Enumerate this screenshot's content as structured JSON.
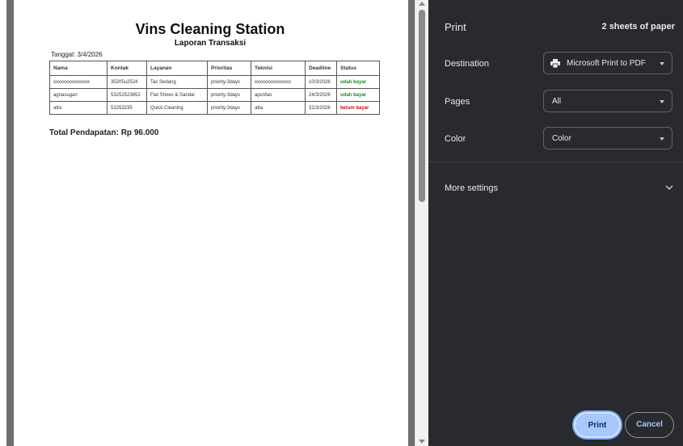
{
  "document": {
    "title": "Vins Cleaning Station",
    "subtitle": "Laporan Transaksi",
    "date_line": "Tanggal: 3/4/2026",
    "columns": [
      "Nama",
      "Kontak",
      "Layanan",
      "Prioritas",
      "Teknisi",
      "Deadline",
      "Status"
    ],
    "rows": [
      [
        "xxxxxxxxxxxxxxx",
        "35205u2524",
        "Tac Sedang",
        "priority-3days",
        "xxxxxxxxxxxxxxx",
        "10/3/2026",
        "udah bayar"
      ],
      [
        "agnasugan",
        "53252523652",
        "Flat Shoes & Sandal",
        "priority-3days",
        "apsnfao",
        "24/3/2026",
        "udah bayar"
      ],
      [
        "atta",
        "53253235",
        "Quick Cleaning",
        "priority-3days",
        "atta",
        "31/3/2026",
        "belum bayar"
      ]
    ],
    "total": "Total Pendapatan: Rp 96.000"
  },
  "panel": {
    "title": "Print",
    "sheet_count": "2 sheets of paper",
    "destination_label": "Destination",
    "destination_value": "Microsoft Print to PDF",
    "pages_label": "Pages",
    "pages_value": "All",
    "color_label": "Color",
    "color_value": "Color",
    "more_settings": "More settings",
    "print_button": "Print",
    "cancel_button": "Cancel"
  },
  "colors": {
    "panel_bg": "#292a2d",
    "primary_button": "#a8c7fa",
    "status_paid": "#1a8c1a",
    "status_unpaid": "#d01010"
  },
  "icons": [
    "printer-icon",
    "chevron-down-icon",
    "scroll-up-arrow-icon",
    "scroll-down-arrow-icon"
  ]
}
